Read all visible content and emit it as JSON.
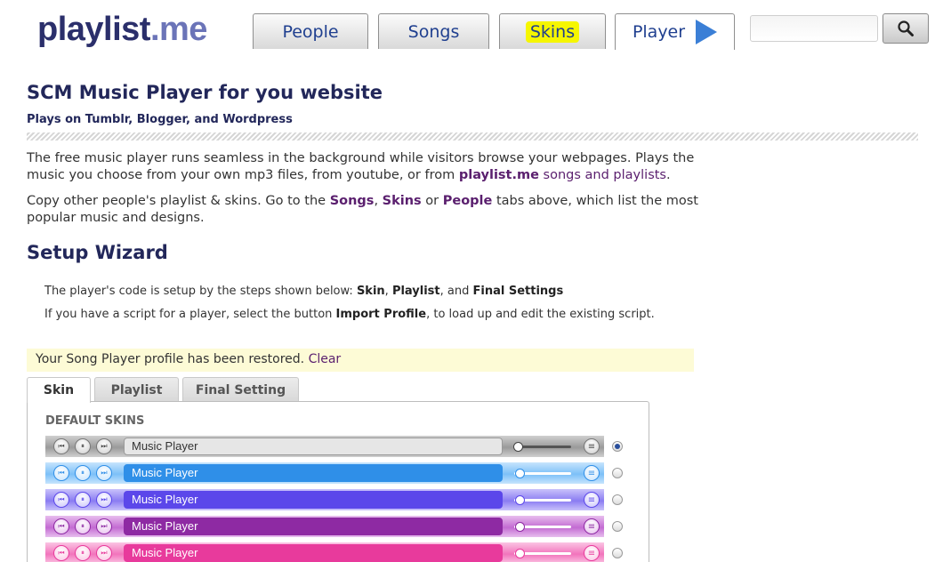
{
  "logo": {
    "text": "playlist",
    "dot": ".",
    "me": "me"
  },
  "nav": {
    "tabs": [
      {
        "label": "People"
      },
      {
        "label": "Songs"
      },
      {
        "label": "Skins"
      },
      {
        "label": "Player"
      }
    ],
    "search_placeholder": ""
  },
  "main": {
    "title": "SCM Music Player for you website",
    "subtitle": "Plays on Tumblr, Blogger, and Wordpress",
    "para1": {
      "text1": "The free music player runs seamless in the background while visitors browse your webpages. Plays the music you choose from your own mp3 files, from youtube, or from ",
      "link_bold": "playlist.me",
      "link_rest": " songs and playlists",
      "end": "."
    },
    "para2": {
      "t1": "Copy other people's playlist & skins. Go to the ",
      "songs": "Songs",
      "comma": ", ",
      "skins": "Skins",
      "or": " or ",
      "people": "People",
      "t2": " tabs above, which list the most popular music and designs."
    },
    "wizard_title": "Setup Wizard",
    "wizard_line1": {
      "t1": "The player's code is setup by the steps shown below: ",
      "skin": "Skin",
      "c1": ", ",
      "playlist": "Playlist",
      "c2": ", and ",
      "final": "Final Settings"
    },
    "wizard_line2": {
      "t1": "If you have a script for a player, select the button ",
      "import": "Import Profile",
      "t2": ", to load up and edit the existing script."
    },
    "notice": {
      "text": "Your Song Player profile has been restored. ",
      "link": "Clear"
    },
    "tabs": [
      {
        "label": "Skin"
      },
      {
        "label": "Playlist"
      },
      {
        "label": "Final Setting"
      }
    ],
    "panel_title": "DEFAULT SKINS",
    "skins": [
      {
        "label": "Music Player",
        "bg": "#9a9a9a",
        "light": "#cfcfcf",
        "field": "#e6e6e6",
        "text": "#333333",
        "selected": true
      },
      {
        "label": "Music Player",
        "bg": "#7cc0f8",
        "light": "#c6e4fd",
        "field": "#2f8fe8",
        "text": "#ffffff",
        "selected": false
      },
      {
        "label": "Music Player",
        "bg": "#8a7cf2",
        "light": "#c9c2fb",
        "field": "#5b47ea",
        "text": "#ffffff",
        "selected": false
      },
      {
        "label": "Music Player",
        "bg": "#c36bd2",
        "light": "#e7bdee",
        "field": "#8e2aa3",
        "text": "#ffffff",
        "selected": false
      },
      {
        "label": "Music Player",
        "bg": "#f274bc",
        "light": "#fbc4e3",
        "field": "#e83a9c",
        "text": "#ffffff",
        "selected": false
      }
    ]
  },
  "colors": {
    "accent": "#5a1f6e",
    "heading": "#22275a",
    "nav_text": "#1f3f8f",
    "highlight": "#f6f600"
  }
}
